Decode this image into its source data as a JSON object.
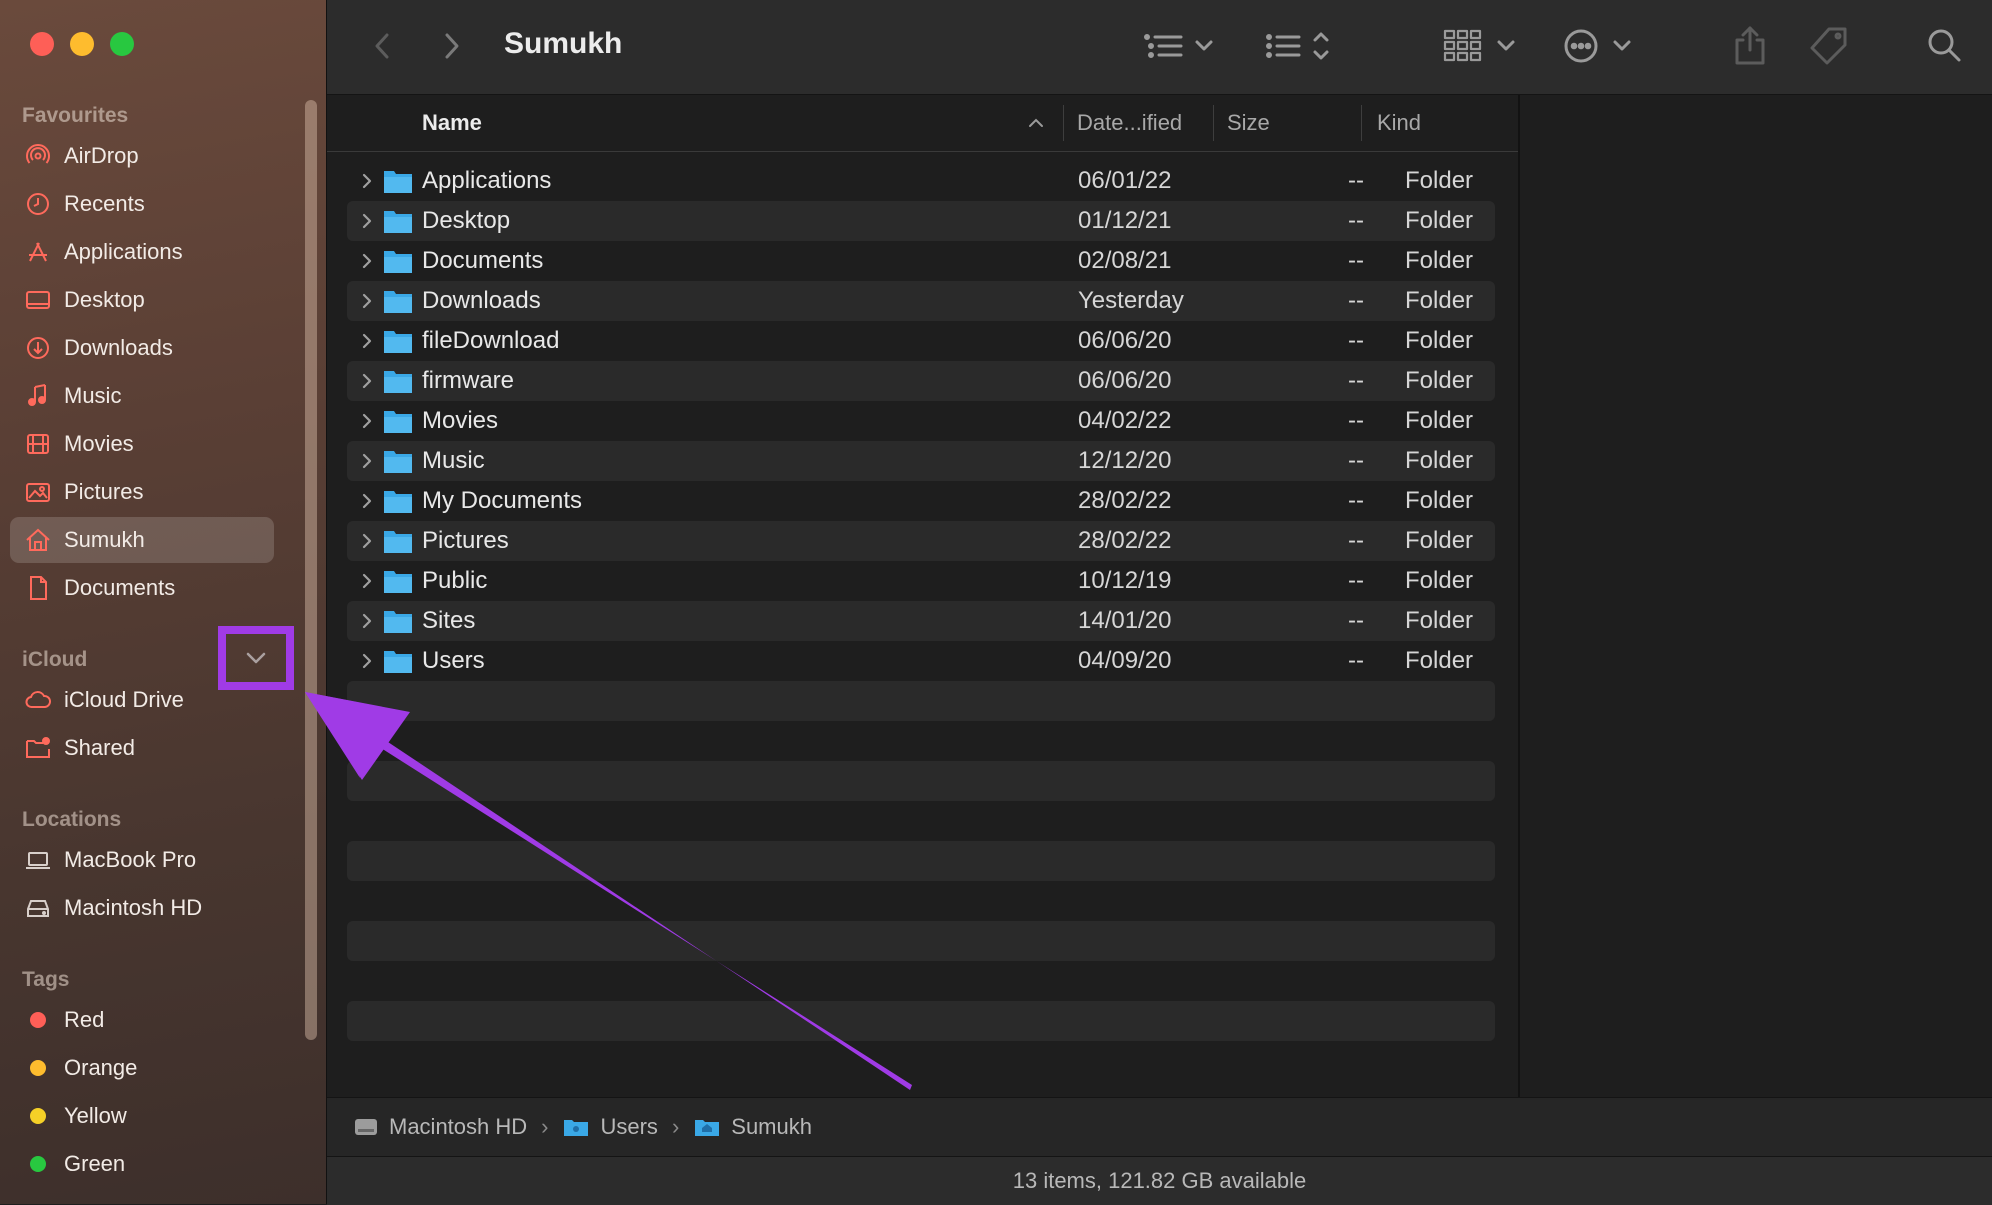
{
  "window": {
    "title": "Sumukh"
  },
  "sidebar": {
    "favourites_label": "Favourites",
    "favourites": [
      {
        "label": "AirDrop",
        "icon": "airdrop-icon"
      },
      {
        "label": "Recents",
        "icon": "clock-icon"
      },
      {
        "label": "Applications",
        "icon": "applications-icon"
      },
      {
        "label": "Desktop",
        "icon": "desktop-icon"
      },
      {
        "label": "Downloads",
        "icon": "download-icon"
      },
      {
        "label": "Music",
        "icon": "music-note-icon"
      },
      {
        "label": "Movies",
        "icon": "film-icon"
      },
      {
        "label": "Pictures",
        "icon": "photo-icon"
      },
      {
        "label": "Sumukh",
        "icon": "home-icon",
        "selected": true
      },
      {
        "label": "Documents",
        "icon": "document-icon"
      }
    ],
    "icloud_label": "iCloud",
    "icloud": [
      {
        "label": "iCloud Drive",
        "icon": "cloud-icon"
      },
      {
        "label": "Shared",
        "icon": "shared-folder-icon"
      }
    ],
    "locations_label": "Locations",
    "locations": [
      {
        "label": "MacBook Pro",
        "icon": "laptop-icon"
      },
      {
        "label": "Macintosh HD",
        "icon": "disk-icon"
      }
    ],
    "tags_label": "Tags",
    "tags": [
      {
        "label": "Red",
        "color": "#fe5f57"
      },
      {
        "label": "Orange",
        "color": "#febc2e"
      },
      {
        "label": "Yellow",
        "color": "#f5d027"
      },
      {
        "label": "Green",
        "color": "#28c840"
      }
    ]
  },
  "columns": {
    "name": "Name",
    "date": "Date...ified",
    "size": "Size",
    "kind": "Kind"
  },
  "files": [
    {
      "name": "Applications",
      "date": "06/01/22",
      "size": "--",
      "kind": "Folder"
    },
    {
      "name": "Desktop",
      "date": "01/12/21",
      "size": "--",
      "kind": "Folder"
    },
    {
      "name": "Documents",
      "date": "02/08/21",
      "size": "--",
      "kind": "Folder"
    },
    {
      "name": "Downloads",
      "date": "Yesterday",
      "size": "--",
      "kind": "Folder"
    },
    {
      "name": "fileDownload",
      "date": "06/06/20",
      "size": "--",
      "kind": "Folder"
    },
    {
      "name": "firmware",
      "date": "06/06/20",
      "size": "--",
      "kind": "Folder"
    },
    {
      "name": "Movies",
      "date": "04/02/22",
      "size": "--",
      "kind": "Folder"
    },
    {
      "name": "Music",
      "date": "12/12/20",
      "size": "--",
      "kind": "Folder"
    },
    {
      "name": "My Documents",
      "date": "28/02/22",
      "size": "--",
      "kind": "Folder"
    },
    {
      "name": "Pictures",
      "date": "28/02/22",
      "size": "--",
      "kind": "Folder"
    },
    {
      "name": "Public",
      "date": "10/12/19",
      "size": "--",
      "kind": "Folder"
    },
    {
      "name": "Sites",
      "date": "14/01/20",
      "size": "--",
      "kind": "Folder"
    },
    {
      "name": "Users",
      "date": "04/09/20",
      "size": "--",
      "kind": "Folder"
    }
  ],
  "pathbar": [
    "Macintosh HD",
    "Users",
    "Sumukh"
  ],
  "status": "13 items, 121.82 GB available",
  "colors": {
    "accent_highlight": "#a03be6",
    "folder": "#3aa8e6",
    "sidebar_icon": "#ff6a5c"
  }
}
